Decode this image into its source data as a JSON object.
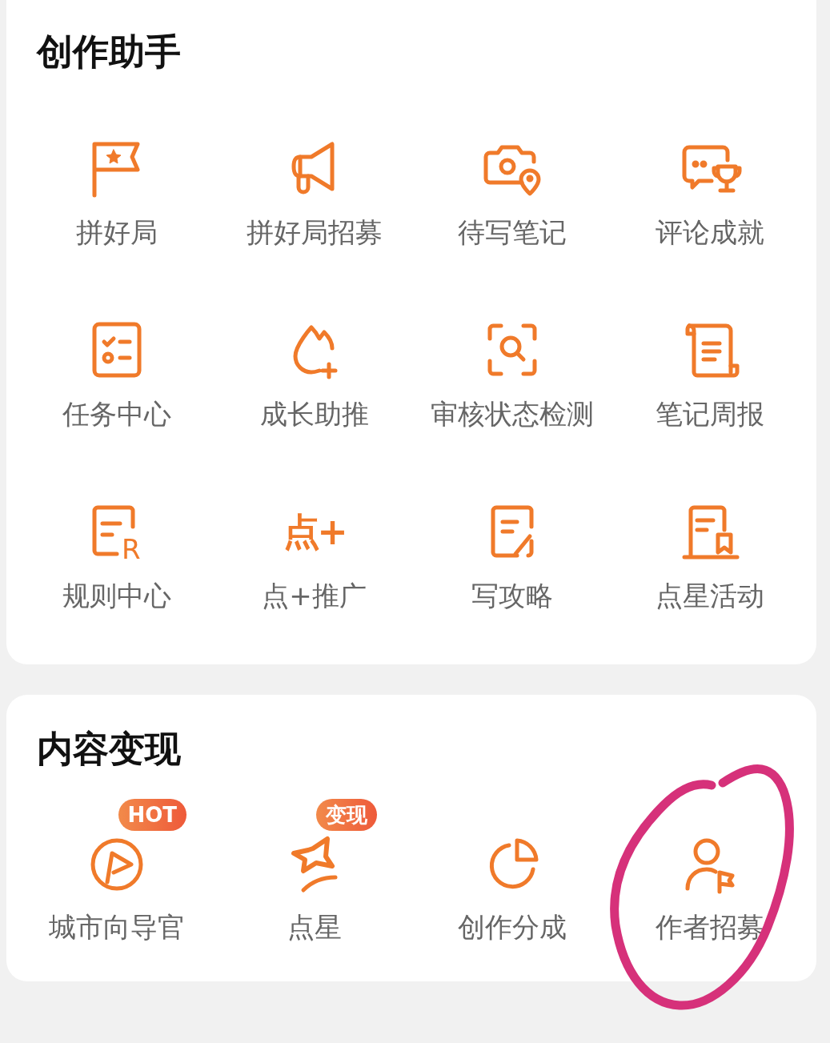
{
  "sections": [
    {
      "title": "创作助手",
      "items": [
        {
          "label": "拼好局",
          "kind": "flag-star"
        },
        {
          "label": "拼好局招募",
          "kind": "megaphone"
        },
        {
          "label": "待写笔记",
          "kind": "camera-pin"
        },
        {
          "label": "评论成就",
          "kind": "chat-trophy"
        },
        {
          "label": "任务中心",
          "kind": "checklist"
        },
        {
          "label": "成长助推",
          "kind": "drop-plus"
        },
        {
          "label": "审核状态检测",
          "kind": "scan-search"
        },
        {
          "label": "笔记周报",
          "kind": "scroll"
        },
        {
          "label": "规则中心",
          "kind": "doc-letter",
          "icon_text": "R"
        },
        {
          "label": "点+推广",
          "kind": "glyph",
          "icon_text": "点+"
        },
        {
          "label": "写攻略",
          "kind": "doc-pen"
        },
        {
          "label": "点星活动",
          "kind": "doc-bookmark"
        }
      ]
    },
    {
      "title": "内容变现",
      "items": [
        {
          "label": "城市向导官",
          "kind": "play-circle",
          "badge": "HOT"
        },
        {
          "label": "点星",
          "kind": "star-swoosh",
          "badge": "变现"
        },
        {
          "label": "创作分成",
          "kind": "pie"
        },
        {
          "label": "作者招募",
          "kind": "person-flag",
          "circled": true
        }
      ]
    }
  ]
}
